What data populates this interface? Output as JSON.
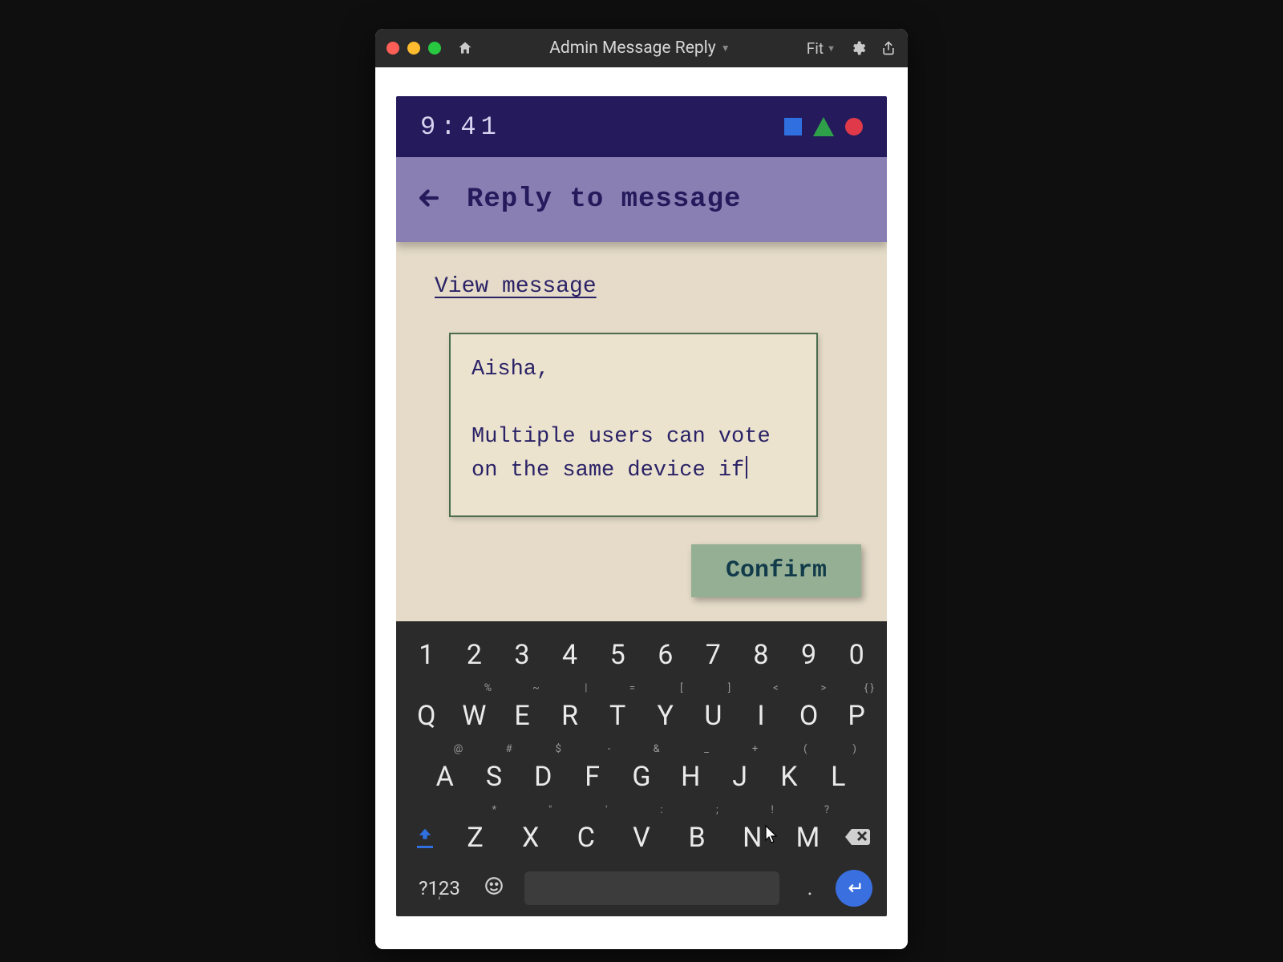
{
  "window": {
    "title": "Admin Message Reply",
    "zoom_label": "Fit"
  },
  "phone": {
    "statusbar": {
      "time": "9:41"
    },
    "appbar": {
      "heading": "Reply to message"
    },
    "view_link": "View message",
    "message_text": "Aisha,\n\nMultiple users can vote on the same device if",
    "confirm_label": "Confirm"
  },
  "keyboard": {
    "row_numbers": [
      "1",
      "2",
      "3",
      "4",
      "5",
      "6",
      "7",
      "8",
      "9",
      "0"
    ],
    "row_q": [
      {
        "k": "Q",
        "h": ""
      },
      {
        "k": "W",
        "h": "%"
      },
      {
        "k": "E",
        "h": "~"
      },
      {
        "k": "R",
        "h": "|"
      },
      {
        "k": "T",
        "h": "="
      },
      {
        "k": "Y",
        "h": "["
      },
      {
        "k": "U",
        "h": "]"
      },
      {
        "k": "I",
        "h": "<"
      },
      {
        "k": "O",
        "h": ">"
      },
      {
        "k": "P",
        "h": "{  }"
      }
    ],
    "row_a": [
      {
        "k": "A",
        "h": "@"
      },
      {
        "k": "S",
        "h": "#"
      },
      {
        "k": "D",
        "h": "$"
      },
      {
        "k": "F",
        "h": "-"
      },
      {
        "k": "G",
        "h": "&"
      },
      {
        "k": "H",
        "h": "_"
      },
      {
        "k": "J",
        "h": "+"
      },
      {
        "k": "K",
        "h": "("
      },
      {
        "k": "L",
        "h": ")"
      }
    ],
    "row_z": [
      {
        "k": "Z",
        "h": "*"
      },
      {
        "k": "X",
        "h": "\""
      },
      {
        "k": "C",
        "h": "'"
      },
      {
        "k": "V",
        "h": ":"
      },
      {
        "k": "B",
        "h": ";"
      },
      {
        "k": "N",
        "h": "!"
      },
      {
        "k": "M",
        "h": "?"
      }
    ],
    "symbols_label": "?123"
  }
}
